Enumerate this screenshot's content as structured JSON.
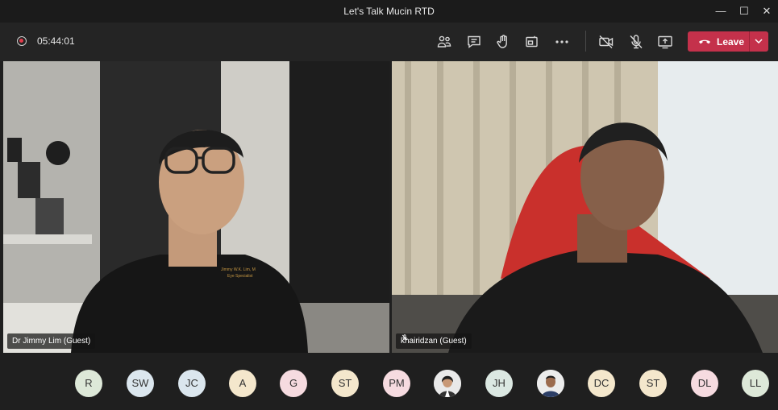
{
  "window": {
    "title": "Let's Talk Mucin RTD",
    "minimize": "—",
    "maximize": "☐",
    "close": "✕"
  },
  "toolbar": {
    "timer": "05:44:01",
    "leave_label": "Leave",
    "icons": [
      "participants-icon",
      "chat-icon",
      "raise-hand-icon",
      "share-tray-icon",
      "more-options-icon",
      "camera-off-icon",
      "mic-off-icon",
      "share-screen-icon"
    ]
  },
  "tiles": [
    {
      "name": "Dr Jimmy Lim (Guest)"
    },
    {
      "name": "khairidzan (Guest)"
    }
  ],
  "participants": [
    {
      "initials": "R",
      "color": "#dde8d8"
    },
    {
      "initials": "SW",
      "color": "#dbe6ee"
    },
    {
      "initials": "JC",
      "color": "#dbe6ee"
    },
    {
      "initials": "A",
      "color": "#f4e7cc"
    },
    {
      "initials": "G",
      "color": "#f6dbe0"
    },
    {
      "initials": "ST",
      "color": "#f4e7cc"
    },
    {
      "initials": "PM",
      "color": "#f6dbe0"
    },
    {
      "initials": "",
      "photo": true
    },
    {
      "initials": "JH",
      "color": "#dbe8e2"
    },
    {
      "initials": "",
      "photo": true
    },
    {
      "initials": "DC",
      "color": "#f4e7cc"
    },
    {
      "initials": "ST",
      "color": "#f4e7cc"
    },
    {
      "initials": "DL",
      "color": "#f6dbe0"
    },
    {
      "initials": "LL",
      "color": "#dde8d8"
    }
  ],
  "colors": {
    "leave": "#c4314b",
    "recording": "#e03b4a"
  }
}
